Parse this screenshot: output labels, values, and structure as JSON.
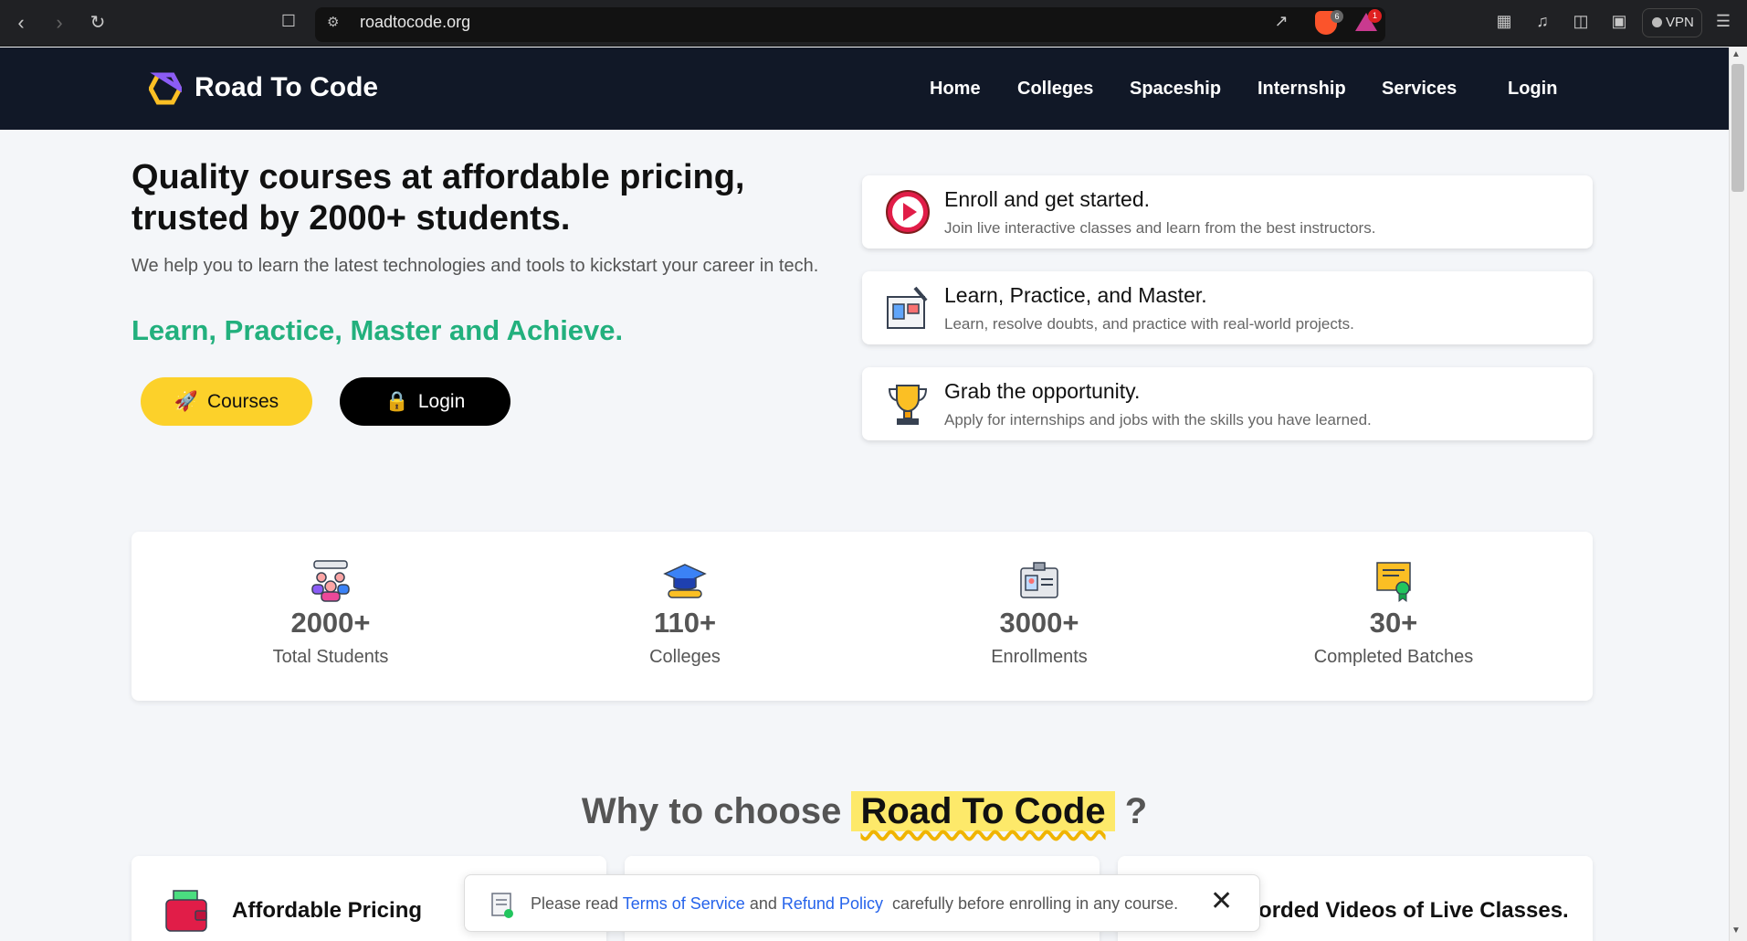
{
  "browser": {
    "url": "roadtocode.org",
    "brave_badge": "6",
    "rewards_badge": "1",
    "vpn_label": "VPN"
  },
  "header": {
    "brand": "Road To Code",
    "nav": [
      "Home",
      "Colleges",
      "Spaceship",
      "Internship",
      "Services",
      "Login"
    ]
  },
  "hero": {
    "title": "Quality courses at affordable pricing, trusted by 2000+ students.",
    "subtitle": "We help you to learn the latest technologies and tools to kickstart your career in tech.",
    "tagline": "Learn, Practice, Master and Achieve.",
    "courses_button": "Courses",
    "login_button": "Login"
  },
  "steps": [
    {
      "title": "Enroll and get started.",
      "desc": "Join live interactive classes and learn from the best instructors.",
      "icon": "play-icon"
    },
    {
      "title": "Learn, Practice, and Master.",
      "desc": "Learn, resolve doubts, and practice with real-world projects.",
      "icon": "books-icon"
    },
    {
      "title": "Grab the opportunity.",
      "desc": "Apply for internships and jobs with the skills you have learned.",
      "icon": "trophy-icon"
    }
  ],
  "stats": [
    {
      "value": "2000+",
      "label": "Total Students",
      "icon": "students-icon"
    },
    {
      "value": "110+",
      "label": "Colleges",
      "icon": "graduation-cap-icon"
    },
    {
      "value": "3000+",
      "label": "Enrollments",
      "icon": "id-card-icon"
    },
    {
      "value": "30+",
      "label": "Completed Batches",
      "icon": "certificate-icon"
    }
  ],
  "why": {
    "prefix": "Why to choose",
    "highlight": "Road To Code",
    "suffix": "?"
  },
  "features": [
    {
      "title": "Affordable Pricing"
    },
    {
      "title": ""
    },
    {
      "title": "Recorded Videos of Live Classes."
    }
  ],
  "toast": {
    "before": "Please read",
    "tos": "Terms of Service",
    "and": "and",
    "refund": "Refund Policy",
    "after": "carefully before enrolling in any course."
  },
  "colors": {
    "header_bg": "#111827",
    "accent_yellow": "#fcd12a",
    "accent_green": "#22b07d",
    "link_blue": "#2563eb"
  }
}
